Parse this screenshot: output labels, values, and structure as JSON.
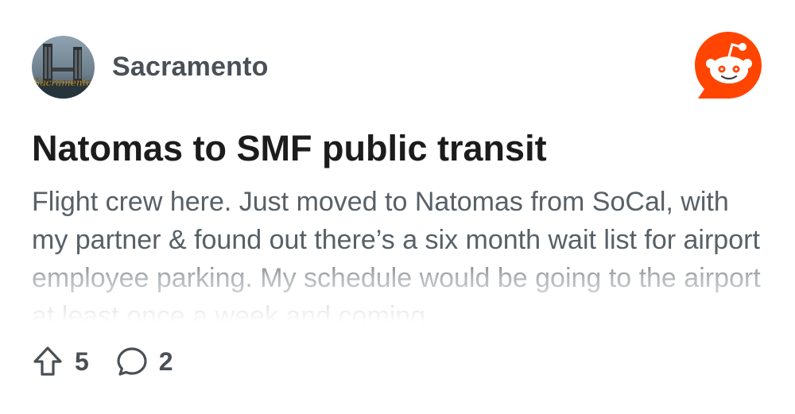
{
  "subreddit": {
    "name": "Sacramento",
    "avatar_caption": "Sacramento",
    "avatar_icon": "tower-bridge-avatar"
  },
  "brand": {
    "logo_icon": "reddit-logo-icon",
    "accent_color": "#ff4500"
  },
  "post": {
    "title": "Natomas to SMF public transit",
    "body": "Flight crew here. Just moved to Natomas from SoCal, with my partner & found out there’s a six month wait list for airport employee parking. My schedule would be going to the airport at least once a week and coming"
  },
  "actions": {
    "upvote_icon": "upvote-arrow-icon",
    "upvote_count": "5",
    "comment_icon": "comment-bubble-icon",
    "comment_count": "2"
  }
}
